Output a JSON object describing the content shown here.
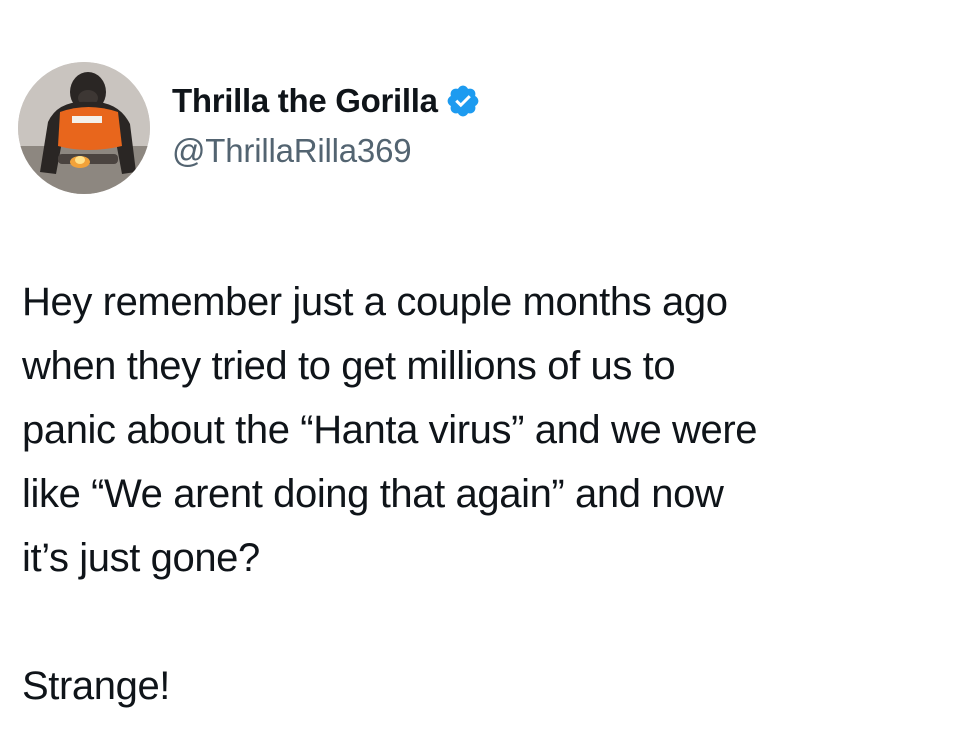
{
  "tweet": {
    "display_name": "Thrilla the Gorilla",
    "handle": "@ThrillaRilla369",
    "verified": true,
    "verified_icon": "verified-badge-icon",
    "verified_color": "#1d9bf0",
    "paragraphs": [
      "Hey remember just a couple months ago\nwhen they tried to get millions of us to\npanic about the “Hanta virus” and we were\nlike “We arent doing that again” and now\nit’s just gone?",
      "Strange!"
    ]
  }
}
